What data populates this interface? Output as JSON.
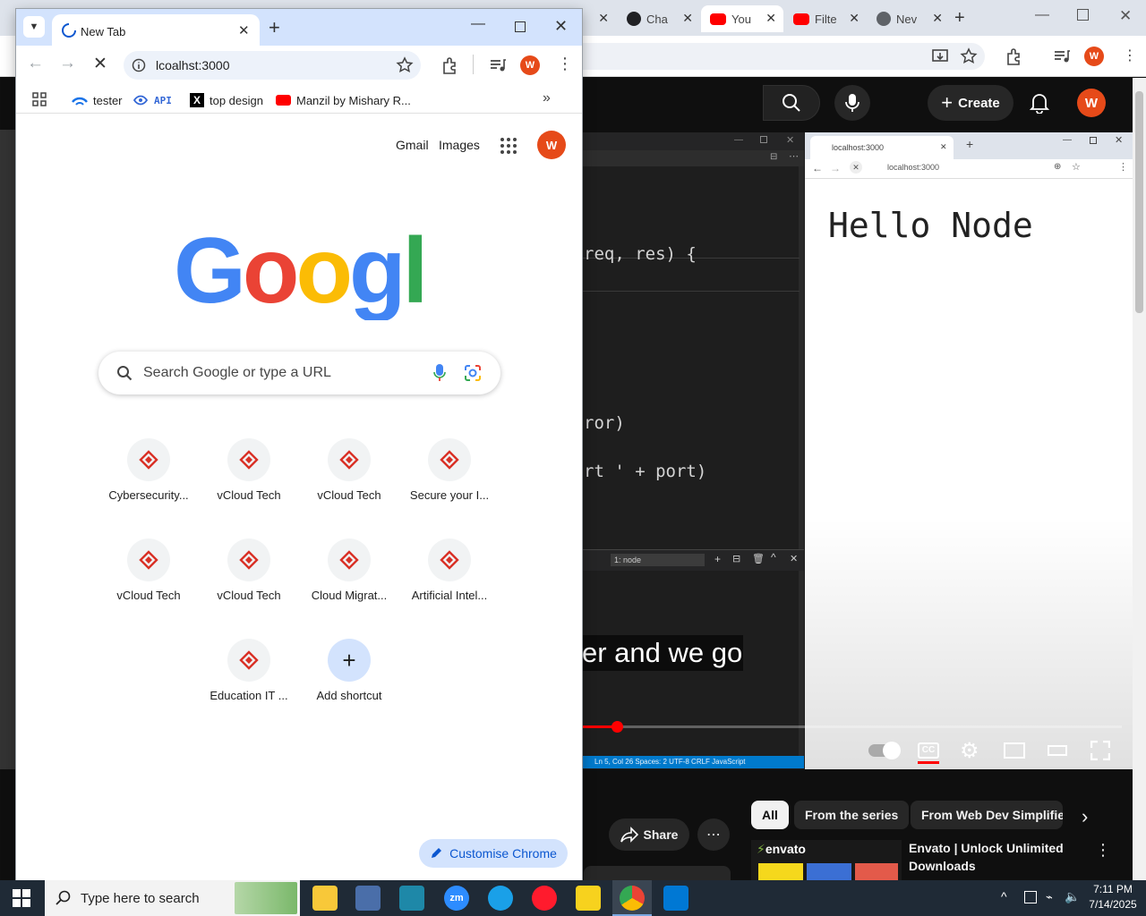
{
  "background_browser": {
    "tabs": [
      {
        "label": "Cha",
        "color": "#202124"
      },
      {
        "label": "You",
        "color": "#ff0000"
      },
      {
        "label": "Filte",
        "color": "#ff0000"
      },
      {
        "label": "Nev",
        "color": "#5f6368"
      }
    ],
    "avatar_letter": "W"
  },
  "youtube": {
    "create_label": "Create",
    "avatar_letter": "W",
    "caption": "er and we go",
    "code_lines": [
      "req, res) {",
      "ror)",
      "rt ' + port)"
    ],
    "terminal_select": "1: node",
    "status_bar": "Ln 5, Col 26   Spaces: 2   UTF-8   CRLF   JavaScript",
    "inner_browser": {
      "tab_title": "localhost:3000",
      "url": "localhost:3000",
      "heading": "Hello Node"
    },
    "chips": [
      "All",
      "From the series",
      "From Web Dev Simplified"
    ],
    "share_label": "Share",
    "ad_brand": "envato",
    "ad_title": "Envato | Unlock Unlimited Downloads"
  },
  "chrome": {
    "tab_title": "New Tab",
    "url": "lcoalhst:3000",
    "profile_letter": "W",
    "bookmarks": [
      {
        "label": "tester"
      },
      {
        "label": "API"
      },
      {
        "label": "top design"
      },
      {
        "label": "Manzil by Mishary R..."
      }
    ],
    "gmail_label": "Gmail",
    "images_label": "Images",
    "search_placeholder": "Search Google or type a URL",
    "shortcuts": [
      "Cybersecurity...",
      "vCloud Tech",
      "vCloud Tech",
      "Secure your I...",
      "vCloud Tech",
      "vCloud Tech",
      "Cloud Migrat...",
      "Artificial Intel...",
      "Education IT ...",
      "Add shortcut"
    ],
    "customise_label": "Customise Chrome",
    "accent": "#0b57d0"
  },
  "taskbar": {
    "search_placeholder": "Type here to search",
    "time": "7:11 PM",
    "date": "7/14/2025"
  }
}
